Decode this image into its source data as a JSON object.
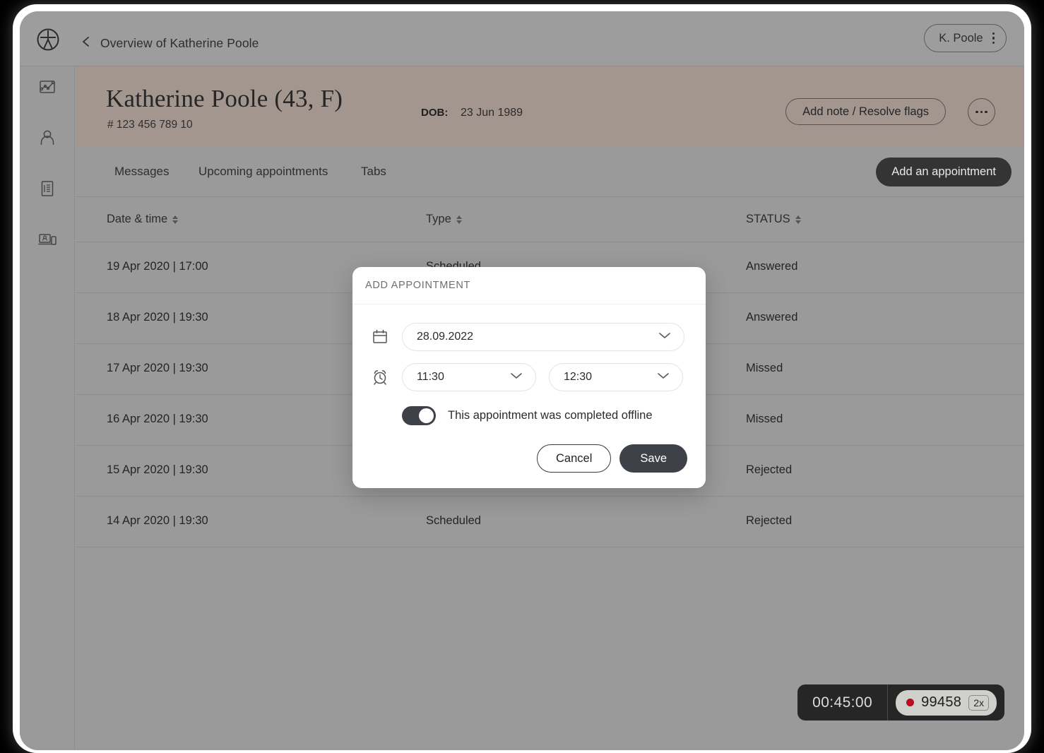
{
  "topbar": {
    "logo_icon": "clinic-logo-icon",
    "back_icon": "chevron-left-icon",
    "breadcrumb": "Overview of Katherine Poole",
    "user_pill": {
      "name": "K. Poole",
      "menu_icon": "kebab-menu-icon"
    }
  },
  "sidebar": {
    "items": [
      {
        "icon": "analytics-chart-icon",
        "name": "analytics"
      },
      {
        "icon": "person-icon",
        "name": "patients"
      },
      {
        "icon": "document-icon",
        "name": "records"
      },
      {
        "icon": "devices-icon",
        "name": "devices"
      }
    ]
  },
  "patient": {
    "name": "Katherine Poole (43,  F)",
    "id": "# 123 456 789 10",
    "dob_label": "DOB:",
    "dob_value": "23 Jun 1989",
    "action_label": "Add note / Resolve flags",
    "more_icon": "ellipsis-icon"
  },
  "tabs": [
    {
      "label": "Messages"
    },
    {
      "label": "Upcoming appointments"
    },
    {
      "label": "Tabs"
    }
  ],
  "primary_action": {
    "label": "Add an appointment"
  },
  "table": {
    "columns": [
      {
        "label": "Date & time",
        "sort_icon": "sort-arrows-icon"
      },
      {
        "label": "Type",
        "sort_icon": "sort-arrows-icon"
      },
      {
        "label": "STATUS",
        "sort_icon": "sort-arrows-icon"
      }
    ],
    "rows": [
      {
        "date": "19 Apr 2020 | 17:00",
        "type": "Scheduled",
        "status": "Answered"
      },
      {
        "date": "18 Apr 2020 | 19:30",
        "type": "",
        "status": "Answered"
      },
      {
        "date": "17 Apr 2020 | 19:30",
        "type": "",
        "status": "Missed"
      },
      {
        "date": "16 Apr 2020 | 19:30",
        "type": "",
        "status": "Missed"
      },
      {
        "date": "15 Apr 2020 | 19:30",
        "type": "",
        "status": "Rejected"
      },
      {
        "date": "14 Apr 2020 | 19:30",
        "type": "Scheduled",
        "status": "Rejected"
      }
    ]
  },
  "modal": {
    "title": "ADD APPOINTMENT",
    "date_field": {
      "icon": "calendar-icon",
      "value": "28.09.2022",
      "chevron": "chevron-down-icon"
    },
    "time_field": {
      "icon": "alarm-clock-icon",
      "start_value": "11:30",
      "end_value": "12:30",
      "chevron": "chevron-down-icon"
    },
    "toggle": {
      "label": "This appointment was completed offline",
      "state": "on"
    },
    "cancel_label": "Cancel",
    "save_label": "Save"
  },
  "recorder": {
    "time": "00:45:00",
    "session_id": "99458",
    "speed": "2x",
    "dot_color": "#bb0b1e"
  },
  "colors": {
    "band": "#a2968f",
    "surface": "#9a9a9a",
    "dark_button": "#343434",
    "modal_dark": "#3e4248"
  }
}
